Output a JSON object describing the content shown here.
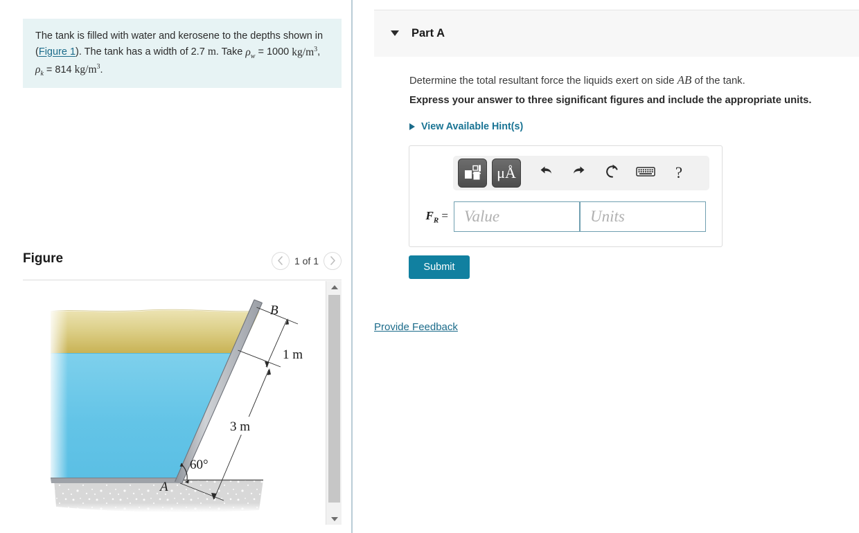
{
  "problem": {
    "text_part1": "The tank is filled with water and kerosene to the depths shown in (",
    "figure_link": "Figure 1",
    "text_part2": "). The tank has a width of 2.7 ",
    "width_unit": "m",
    "text_part3": ". Take ",
    "rho_w_symbol": "ρ",
    "rho_w_sub": "w",
    "rho_w_eq": " = 1000 ",
    "rho_w_unit": "kg/m",
    "rho_w_exp": "3",
    "rho_k_symbol": "ρ",
    "rho_k_sub": "k",
    "rho_k_eq": " = 814 ",
    "rho_k_unit": "kg/m",
    "rho_k_exp": "3",
    "background_color": "#e7f3f4"
  },
  "figure": {
    "title": "Figure",
    "page_count_label": "1 of 1",
    "prev_icon": "chevron-left-icon",
    "next_icon": "chevron-right-icon",
    "labels": {
      "point_a": "A",
      "point_b": "B",
      "dim_top": "1 m",
      "dim_bottom": "3 m",
      "angle": "60°"
    },
    "colors": {
      "kerosene_top": "#e6dca4",
      "kerosene_bottom": "#cdb85c",
      "water": "#6cc8e9",
      "ground": "#d2d2d2",
      "plate": "#b9bcc0"
    },
    "geometry_note": {
      "kerosene_depth_m": 1,
      "water_depth_m": 3,
      "plate_angle_deg": 60,
      "tank_width_m": 2.7
    }
  },
  "part_a": {
    "caret_icon": "caret-down-icon",
    "label": "Part A",
    "question_pre": "Determine the total resultant force the liquids exert on side ",
    "question_math": "AB",
    "question_post": " of the tank.",
    "instruction": "Express your answer to three significant figures and include the appropriate units.",
    "hints_caret_icon": "caret-right-icon",
    "hints_label": "View Available Hint(s)",
    "accent_color": "#1a7494"
  },
  "answer": {
    "toolbar": {
      "template_icon": "math-template-icon",
      "units_label": "μÅ",
      "undo_icon": "undo-arrow-icon",
      "redo_icon": "redo-arrow-icon",
      "reset_icon": "reset-circular-arrow-icon",
      "keyboard_icon": "keyboard-icon",
      "help_label": "?"
    },
    "variable_symbol": "F",
    "variable_subscript": "R",
    "equals": " =",
    "value_placeholder": "Value",
    "value": "",
    "units_placeholder": "Units",
    "units": ""
  },
  "actions": {
    "submit_label": "Submit",
    "submit_color": "#1180a0",
    "feedback_label": "Provide Feedback"
  },
  "scrollbar": {
    "up_icon": "scroll-up-arrow-icon",
    "down_icon": "scroll-down-arrow-icon",
    "thumb_name": "scroll-thumb"
  }
}
